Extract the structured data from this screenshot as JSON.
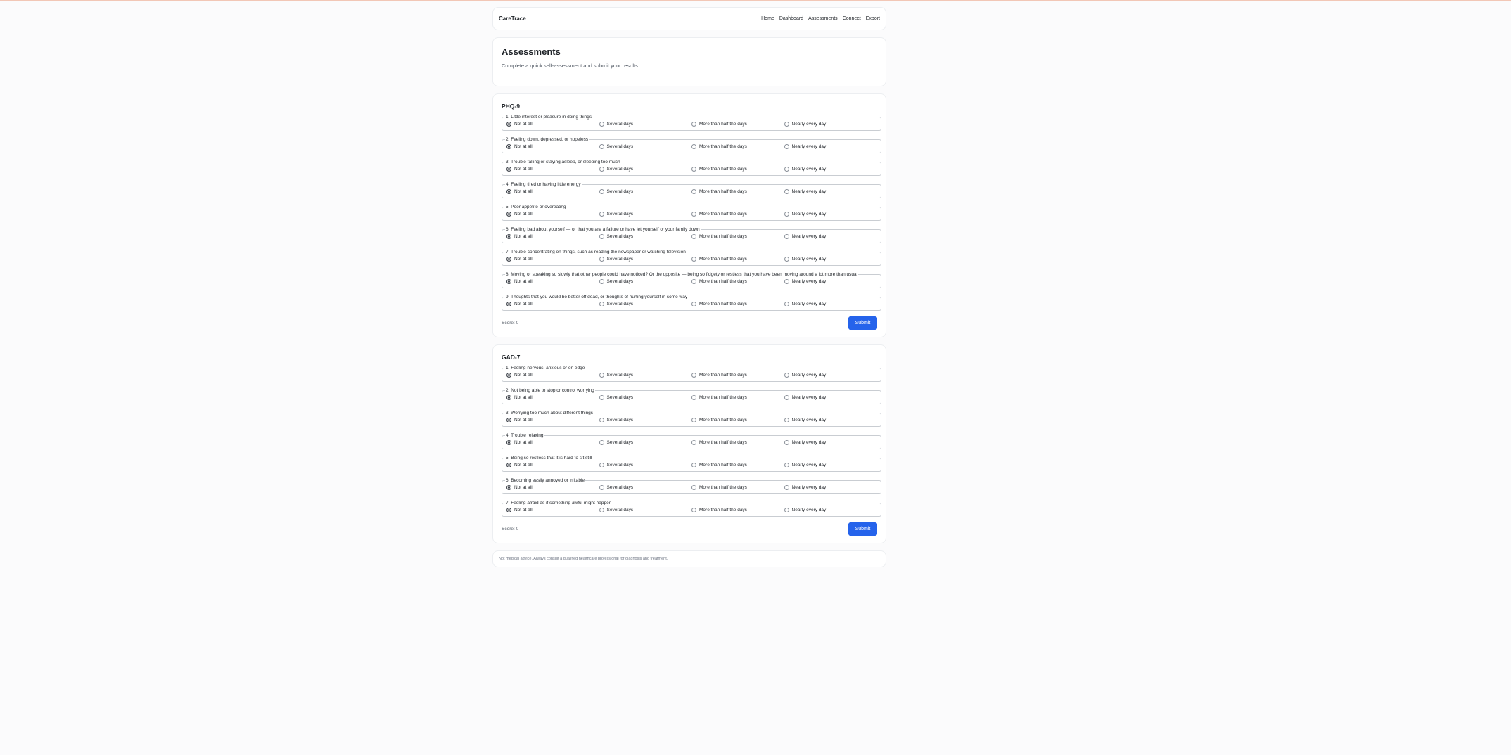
{
  "nav": {
    "brand": "CareTrace",
    "links": [
      "Home",
      "Dashboard",
      "Assessments",
      "Connect",
      "Export"
    ]
  },
  "intro": {
    "title": "Assessments",
    "subtitle": "Complete a quick self-assessment and submit your results."
  },
  "options": [
    "Not at all",
    "Several days",
    "More than half the days",
    "Nearly every day"
  ],
  "phq": {
    "title": "PHQ-9",
    "questions": [
      "1. Little interest or pleasure in doing things",
      "2. Feeling down, depressed, or hopeless",
      "3. Trouble falling or staying asleep, or sleeping too much",
      "4. Feeling tired or having little energy",
      "5. Poor appetite or overeating",
      "6. Feeling bad about yourself — or that you are a failure or have let yourself or your family down",
      "7. Trouble concentrating on things, such as reading the newspaper or watching television",
      "8. Moving or speaking so slowly that other people could have noticed? Or the opposite — being so fidgety or restless that you have been moving around a lot more than usual",
      "9. Thoughts that you would be better off dead, or thoughts of hurting yourself in some way"
    ],
    "score": "Score: 0",
    "submit": "Submit"
  },
  "gad": {
    "title": "GAD-7",
    "questions": [
      "1. Feeling nervous, anxious or on edge",
      "2. Not being able to stop or control worrying",
      "3. Worrying too much about different things",
      "4. Trouble relaxing",
      "5. Being so restless that it is hard to sit still",
      "6. Becoming easily annoyed or irritable",
      "7. Feeling afraid as if something awful might happen"
    ],
    "score": "Score: 0",
    "submit": "Submit"
  },
  "disclaimer": "Not medical advice. Always consult a qualified healthcare professional for diagnosis and treatment.",
  "colors": {
    "accent": "#2563eb",
    "top_line": "#f2c7b6"
  }
}
